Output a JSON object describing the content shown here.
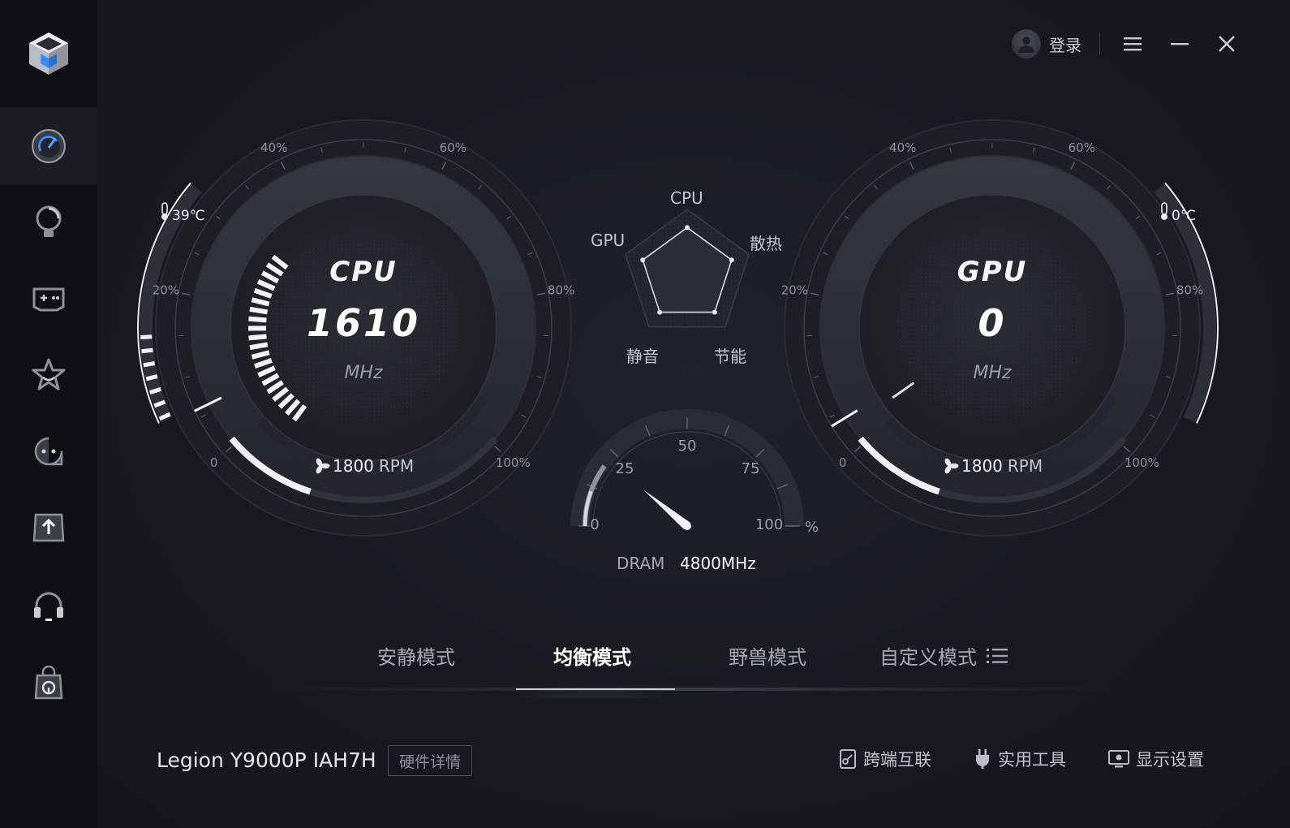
{
  "window": {
    "login_label": "登录"
  },
  "cpu_gauge": {
    "label": "CPU",
    "value": "1610",
    "unit": "MHz",
    "temperature": "39℃",
    "fan": "1800",
    "fan_unit": "RPM",
    "ticks": [
      "0",
      "20%",
      "40%",
      "60%",
      "80%",
      "100%"
    ],
    "load_fraction": 0.06,
    "temp_fraction": 0.35
  },
  "gpu_gauge": {
    "label": "GPU",
    "value": "0",
    "unit": "MHz",
    "temperature": "0℃",
    "fan": "1800",
    "fan_unit": "RPM",
    "ticks": [
      "0",
      "20%",
      "40%",
      "60%",
      "80%",
      "100%"
    ],
    "load_fraction": 0.04,
    "temp_fraction": 1.0
  },
  "radar": {
    "labels": {
      "cpu": "CPU",
      "cooling": "散热",
      "power_saving": "节能",
      "silent": "静音",
      "gpu": "GPU"
    },
    "values": [
      0.72,
      0.72,
      0.72,
      0.72,
      0.72
    ]
  },
  "dram": {
    "ticks": [
      "0",
      "25",
      "50",
      "75",
      "100"
    ],
    "unit": "%",
    "label": "DRAM",
    "value": "4800MHz",
    "usage_percent": 20
  },
  "modes": [
    {
      "label": "安静模式",
      "active": false
    },
    {
      "label": "均衡模式",
      "active": true
    },
    {
      "label": "野兽模式",
      "active": false
    },
    {
      "label": "自定义模式",
      "active": false
    }
  ],
  "footer": {
    "device": "Legion Y9000P IAH7H",
    "hardware_details": "硬件详情",
    "tools": [
      {
        "label": "跨端互联",
        "icon": "cross-device-icon"
      },
      {
        "label": "实用工具",
        "icon": "plug-icon"
      },
      {
        "label": "显示设置",
        "icon": "monitor-icon"
      }
    ]
  },
  "sidebar": {
    "items": [
      {
        "icon": "dashboard-icon",
        "active": true
      },
      {
        "icon": "lightbulb-icon",
        "active": false
      },
      {
        "icon": "gamepad-icon",
        "active": false
      },
      {
        "icon": "star-icon",
        "active": false
      },
      {
        "icon": "assistant-icon",
        "active": false
      },
      {
        "icon": "upload-icon",
        "active": false
      },
      {
        "icon": "headset-icon",
        "active": false
      },
      {
        "icon": "store-bag-icon",
        "active": false
      }
    ]
  },
  "colors": {
    "background": "#16181d",
    "sidebar": "#0f1013",
    "accent": "#ffffff",
    "gauge_ring": "#2b2e35"
  }
}
